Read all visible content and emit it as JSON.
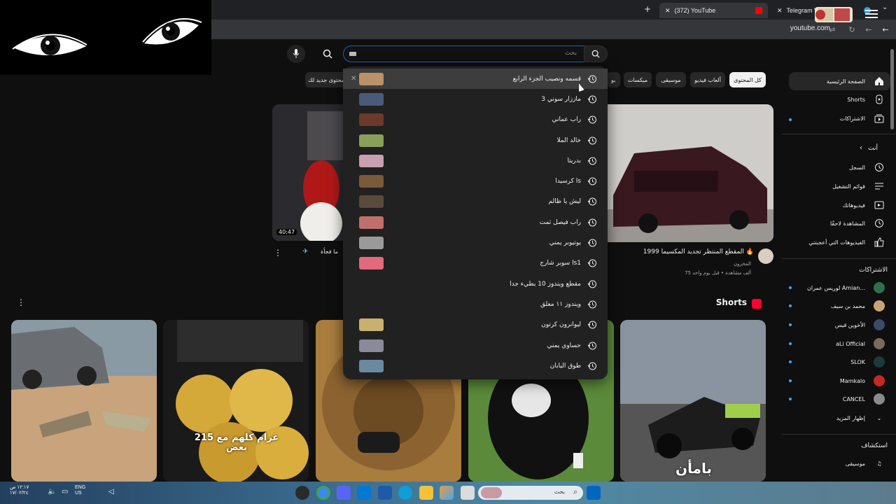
{
  "browser": {
    "tabs": [
      {
        "label": "(372) YouTube",
        "active": true
      },
      {
        "label": "Telegram Web",
        "active": false
      }
    ],
    "url": "youtube.com"
  },
  "search": {
    "placeholder": "بحث",
    "suggestions": [
      {
        "text": "قسمه ونصيب الجزء الرابع",
        "has_thumb": true,
        "hover": true
      },
      {
        "text": "ماززار سوني 3",
        "has_thumb": true
      },
      {
        "text": "راب عماني",
        "has_thumb": true
      },
      {
        "text": "خالد الملا",
        "has_thumb": true
      },
      {
        "text": "بدريتا",
        "has_thumb": true
      },
      {
        "text": "كرسيدا ls",
        "has_thumb": true
      },
      {
        "text": "ليش يا ظالم",
        "has_thumb": true
      },
      {
        "text": "راب فيصل ثمت",
        "has_thumb": true
      },
      {
        "text": "يوتيوبر يمني",
        "has_thumb": true
      },
      {
        "text": "سوبر شارج ls1",
        "has_thumb": true
      },
      {
        "text": "مقطع ويندوز 10 بطيء جدا",
        "has_thumb": false
      },
      {
        "text": "ويندوز ١١ معلق",
        "has_thumb": false
      },
      {
        "text": "ليوانرون كرتون",
        "has_thumb": true
      },
      {
        "text": "حساوي يمني",
        "has_thumb": true
      },
      {
        "text": "طوق اليابان",
        "has_thumb": true
      }
    ]
  },
  "chips": [
    "كل المحتوى",
    "ألعاب فيديو",
    "موسيقى",
    "ميكسات",
    "بو",
    "محتوى جديد لك"
  ],
  "sidebar": {
    "main": [
      {
        "label": "الصفحة الرئيسية",
        "icon": "home-icon",
        "active": true
      },
      {
        "label": "Shorts",
        "icon": "shorts-icon"
      },
      {
        "label": "الاشتراكات",
        "icon": "subscriptions-icon"
      }
    ],
    "you_header": "أنت",
    "you": [
      {
        "label": "السجل",
        "icon": "history-icon"
      },
      {
        "label": "قوائم التشغيل",
        "icon": "playlists-icon"
      },
      {
        "label": "فيديوهاتك",
        "icon": "your-videos-icon"
      },
      {
        "label": "المشاهدة لاحقًا",
        "icon": "watch-later-icon"
      },
      {
        "label": "الفيديوهات التي أعجبتني",
        "icon": "liked-icon"
      }
    ],
    "subs_header": "الاشتراكات",
    "subs": [
      {
        "label": "لوريس عمران Amian...",
        "color": "#2f6f4e"
      },
      {
        "label": "محمد بن سيف",
        "color": "#c9a27a"
      },
      {
        "label": "الأخوين قيس",
        "color": "#3c4a6a"
      },
      {
        "label": "aLi Official",
        "color": "#7a6a5a"
      },
      {
        "label": "SLOK",
        "color": "#1b3a3a"
      },
      {
        "label": "Mamkalo",
        "color": "#c62828"
      },
      {
        "label": "CANCEL",
        "color": "#8a8a8a"
      }
    ],
    "show_more": "إظهار المزيد",
    "explore_header": "استكشاف",
    "explore": [
      {
        "label": "موسيقى",
        "icon": "music-icon"
      }
    ]
  },
  "video": {
    "duration": "40:47",
    "title_right": "المقطع المنتظر تجديد المكسيما 1999 🔥",
    "channel_right": "المخزون",
    "meta_right": "75 ألف مشاهدة • قبل يوم واحد",
    "title_left": "ما فجأة"
  },
  "shorts": {
    "heading": "Shorts",
    "overlay_gold": "215 غرام كلهم مع بعض",
    "overlay_last": "بامأن"
  },
  "taskbar": {
    "search_placeholder": "بحث",
    "lang": "ENG",
    "lang_sub": "US",
    "time": "١٢:١٧ ص",
    "date": "١٧/٠٢/٢٤"
  },
  "colors": {
    "accent": "#3ea6ff",
    "youtube_red": "#ff0000",
    "focus": "#1c62b9"
  }
}
